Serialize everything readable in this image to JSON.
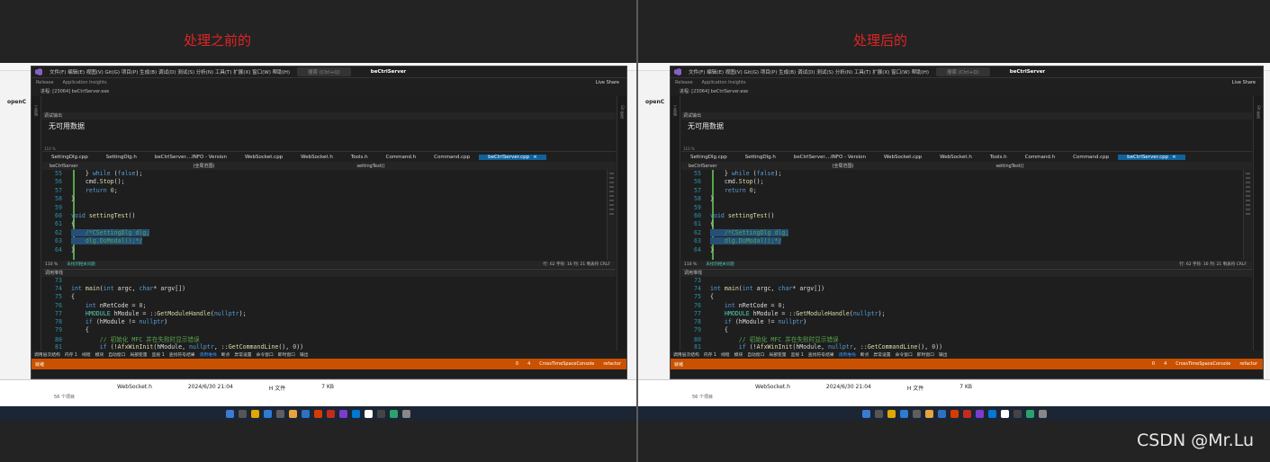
{
  "panels": [
    {
      "caption": "处理之前的",
      "process": "进程: [23064] beCtrlServer.exe"
    },
    {
      "caption": "处理后的",
      "process": "进程: [23064] beCtrlServer.exe"
    }
  ],
  "vs": {
    "menu": "文件(F)  编辑(E)  视图(V)  Git(G)  项目(P)  生成(B)  调试(D)  测试(S)  分析(N)  工具(T)  扩展(X)  窗口(W)  帮助(H)",
    "search_placeholder": "搜索 (Ctrl+Q)",
    "project": "beCtrlServer",
    "release": "Release",
    "insights": "Application Insights",
    "live_share": "Live Share",
    "output_title": "调试输出",
    "output_message": "无可用数据",
    "zoom": "110 %",
    "tabs": [
      "SettingDlg.cpp",
      "SettingDlg.h",
      "beCtrlServer....INFO - Version",
      "WebSocket.cpp",
      "WebSocket.h",
      "Tools.h",
      "Command.h",
      "Command.cpp"
    ],
    "active_tab": "beCtrlServer.cpp",
    "nav_project": "beCtrlServer",
    "nav_scope": "(全局范围)",
    "nav_func": "settingTest()",
    "editor_status_ok": "未找到相关问题",
    "editor_status_pos": "行: 62   字符: 16   列: 21   制表符   CRLF",
    "lower_title": "调用堆栈",
    "bottom_tabs": [
      "调用层次结构",
      "内存 1",
      "线程",
      "模块",
      "自动窗口",
      "局部变量",
      "监视 1",
      "查找符号结果",
      "调用堆栈",
      "断点",
      "异常设置",
      "命令窗口",
      "即时窗口",
      "输出"
    ],
    "bottom_active": "调用堆栈",
    "status_ready": "就绪",
    "status_branch": "CrossTimeSpaceConsole",
    "status_repo": "refactor",
    "status_errors": "0",
    "status_changes": "4"
  },
  "code_top": [
    {
      "n": "55",
      "t": "    } while (false);"
    },
    {
      "n": "56",
      "t": "    cmd.Stop();"
    },
    {
      "n": "57",
      "t": "    return 0;"
    },
    {
      "n": "58",
      "t": "}"
    },
    {
      "n": "59",
      "t": ""
    },
    {
      "n": "60",
      "t": "void settingTest()"
    },
    {
      "n": "61",
      "t": "{"
    },
    {
      "n": "62",
      "t": "    /*CSettingDlg dlg;"
    },
    {
      "n": "63",
      "t": "    dlg.DoModal();*/"
    },
    {
      "n": "64",
      "t": "}"
    }
  ],
  "code_bottom": [
    {
      "n": "73",
      "t": ""
    },
    {
      "n": "74",
      "t": "int main(int argc, char* argv[])"
    },
    {
      "n": "75",
      "t": "{"
    },
    {
      "n": "76",
      "t": "    int nRetCode = 0;"
    },
    {
      "n": "77",
      "t": "    HMODULE hModule = ::GetModuleHandle(nullptr);"
    },
    {
      "n": "78",
      "t": "    if (hModule != nullptr)"
    },
    {
      "n": "79",
      "t": "    {"
    },
    {
      "n": "80",
      "t": "        // 初始化 MFC 并在失败时显示错误"
    },
    {
      "n": "81",
      "t": "        if (!AfxWinInit(hModule, nullptr, ::GetCommandLine(), 0))"
    }
  ],
  "desktop": {
    "side_label": "openC",
    "file_name": "WebSocket.h",
    "file_date": "2024/6/30 21:04",
    "file_type": "H 文件",
    "file_size": "7 KB",
    "file_status": "56 个项目"
  },
  "taskbar_colors": [
    "#3a7bd5",
    "#555555",
    "#e0a800",
    "#2f7bd1",
    "#5e5e5e",
    "#e8a33d",
    "#3070c0",
    "#d83b01",
    "#c42b1c",
    "#7d3ccf",
    "#0078d4",
    "#ffffff",
    "#444444",
    "#2aa36b",
    "#888888"
  ],
  "watermark": "CSDN @Mr.Lu"
}
